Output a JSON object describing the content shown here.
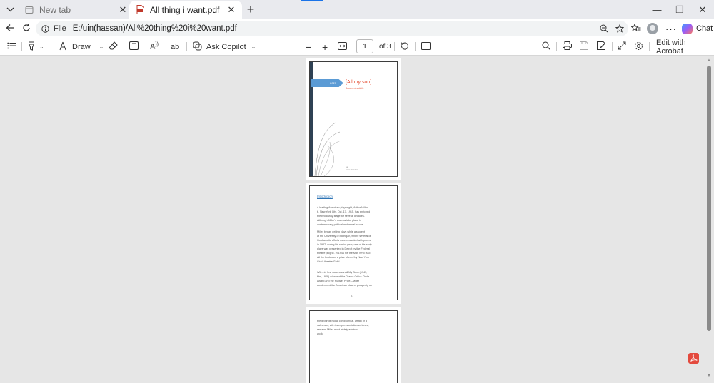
{
  "browser": {
    "tabs": [
      {
        "title": "New tab",
        "icon": "new-tab-page-icon",
        "active": false
      },
      {
        "title": "All thing i want.pdf",
        "icon": "pdf-file-icon",
        "active": true
      }
    ],
    "window_controls": {
      "minimize": "—",
      "restore": "❐",
      "close": "✕"
    },
    "address": {
      "scheme_label": "File",
      "url": "E:/uin(hassan)/All%20thing%20i%20want.pdf"
    },
    "chat_label": "Chat"
  },
  "pdf_toolbar": {
    "draw_label": "Draw",
    "ask_copilot_label": "Ask Copilot",
    "page_number": "1",
    "page_total": "of 3",
    "edit_acrobat_label": "Edit with Acrobat",
    "icons": [
      "contents-icon",
      "highlight-icon",
      "draw-icon",
      "eraser-icon",
      "text-box-icon",
      "read-aloud-icon",
      "translate-icon",
      "copilot-icon",
      "zoom-out-icon",
      "zoom-in-icon",
      "fit-page-icon",
      "rotate-icon",
      "page-view-icon",
      "search-icon",
      "print-icon",
      "save-icon",
      "save-as-icon",
      "fullscreen-icon",
      "settings-icon"
    ]
  },
  "document": {
    "cover": {
      "title": "[All my son]",
      "subtitle": "Document subtitle",
      "year": "2023",
      "author_lines": [
        "p.a",
        "name of author"
      ]
    },
    "page2": {
      "heading": "Introduction",
      "paragraphs": [
        "A leading American playwright, Arthur Miller,\nb. New York City, Oct. 17, 1915, has enriched\nthe Broadway stage for several decades.\nAlthough Miller's dramas take place in\ncontemporary political and moral issues.",
        "Miller began writing plays while a student\nat the University of Michigan, where several of\nhis dramatic efforts were rewarded with prizes\nin 1937, during his senior year; one of his early\nplays was presented in Detroit by the Federal\ntheatre project. In 1944 his the Man Who Had\nAll the Luck won a prize offered by New York\nCiro's theatre Guild.",
        "With his first successes All My Sons (1947;\nfilm, 1948) winner of the Drama Critics Circle\nAward and the Pulitzer Prize—Miller\ncondemned the American ideal of prosperity on"
      ],
      "page_number": "1"
    },
    "page3": {
      "paragraph": "the grounds moral compromise. Death of a\nsalesman, with its expressionistic overtones,\nremains Miller most widely admired\nwork."
    }
  },
  "colors": {
    "accent": "#1a73e8",
    "cover_title": "#e44a2f",
    "cover_pentagon": "#5b9bd5",
    "cover_bar": "#2f4154",
    "heading": "#2e74b5",
    "acrobat_red": "#e34a3e"
  }
}
